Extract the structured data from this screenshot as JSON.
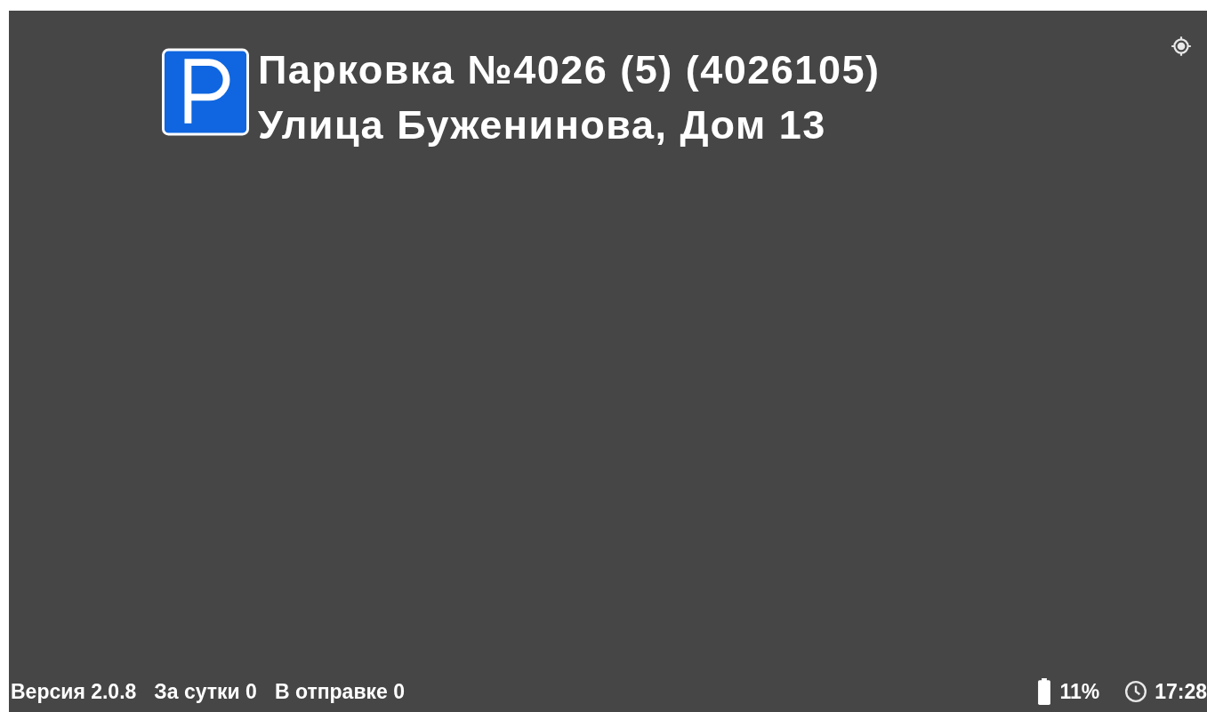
{
  "header": {
    "title": "Парковка №4026 (5) (4026105)",
    "address": "Улица Буженинова, Дом 13"
  },
  "status_bar": {
    "left": [
      "Версия 2.0.8",
      "За сутки 0",
      "В отправке 0"
    ],
    "battery": "11%",
    "time": "17:28"
  }
}
